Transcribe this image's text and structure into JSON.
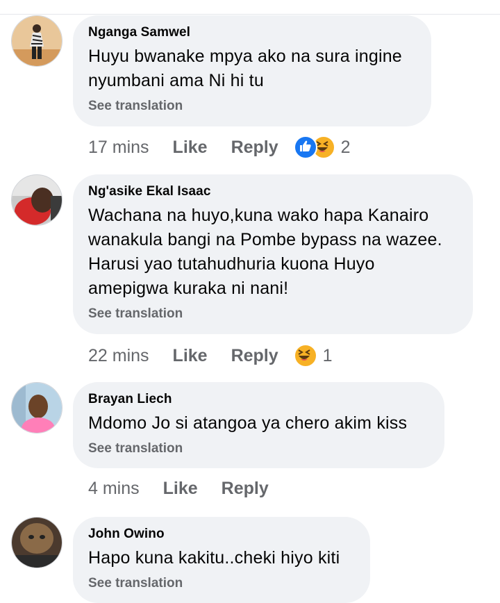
{
  "comments": [
    {
      "author": "Nganga Samwel",
      "text": "Huyu bwanake mpya ako na sura ingine nyumbani ama Ni hi tu",
      "translate": "See translation",
      "time": "17 mins",
      "like": "Like",
      "reply": "Reply",
      "reactions": [
        "like-icon",
        "haha-icon"
      ],
      "reaction_count": "2"
    },
    {
      "author": "Ng'asike Ekal Isaac",
      "text": "Wachana na huyo,kuna wako hapa Kanairo wanakula bangi na Pombe bypass na wazee. Harusi yao tutahudhuria kuona Huyo amepigwa kuraka ni nani!",
      "translate": "See translation",
      "time": "22 mins",
      "like": "Like",
      "reply": "Reply",
      "reactions": [
        "haha-icon"
      ],
      "reaction_count": "1"
    },
    {
      "author": "Brayan Liech",
      "text": "Mdomo Jo si atangoa ya chero akim kiss",
      "translate": "See translation",
      "time": "4 mins",
      "like": "Like",
      "reply": "Reply"
    },
    {
      "author": "John Owino",
      "text": "Hapo kuna kakitu..cheki hiyo kiti",
      "translate": "See translation"
    }
  ],
  "colors": {
    "bubble": "#f0f2f5",
    "secondary_text": "#65676b",
    "like_blue": "#1877f2",
    "haha_yellow": "#f7b125"
  }
}
